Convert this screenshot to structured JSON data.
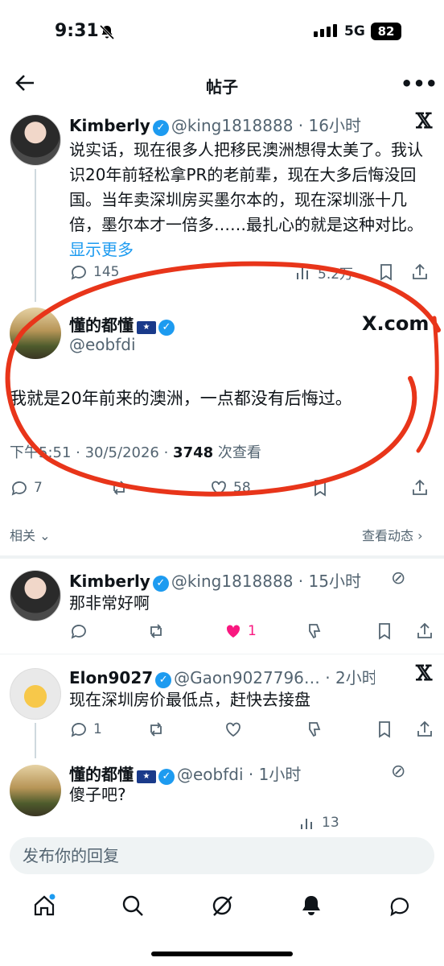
{
  "status_bar": {
    "time": "9:31",
    "network": "5G",
    "battery": "82"
  },
  "header": {
    "title": "帖子"
  },
  "quoted_tweet": {
    "name": "Kimberly",
    "handle": "@king1818888",
    "time": "16小时",
    "text": "说实话，现在很多人把移民澳洲想得太美了。我认识20年前轻松拿PR的老前辈，现在大多后悔没回国。当年卖深圳房买墨尔本的，现在深圳涨十几倍，墨尔本才一倍多……最扎心的就是这种对比。",
    "show_more": "显示更多",
    "replies": "145",
    "views": "5.2万"
  },
  "main_tweet": {
    "name": "懂的都懂",
    "flag": "🇦🇺",
    "handle": "@eobfdi",
    "text": "我就是20年前来的澳洲，一点都没有后悔过。",
    "timestamp": "下午5:51 · 30/5/2026 · ",
    "view_count": "3748",
    "view_label": " 次查看",
    "replies": "7",
    "likes": "58",
    "watermark": "X.com"
  },
  "related": {
    "left": "相关",
    "right": "查看动态"
  },
  "replies": [
    {
      "name": "Kimberly",
      "handle": "@king1818888",
      "time": "15小时",
      "text": "那非常好啊",
      "likes": "1"
    },
    {
      "name": "Elon9027",
      "handle": "@Gaon9027796…",
      "time": "2小时",
      "text": "现在深圳房价最低点，赶快去接盘",
      "replies": "1"
    },
    {
      "name": "懂的都懂",
      "flag": "🇦🇺",
      "handle": "@eobfdi",
      "time": "1小时",
      "text": "傻子吧?",
      "views": "13"
    }
  ],
  "composer": {
    "placeholder": "发布你的回复"
  },
  "colors": {
    "accent": "#1d9bf0",
    "like": "#f91880",
    "annotation": "#e8351a"
  }
}
